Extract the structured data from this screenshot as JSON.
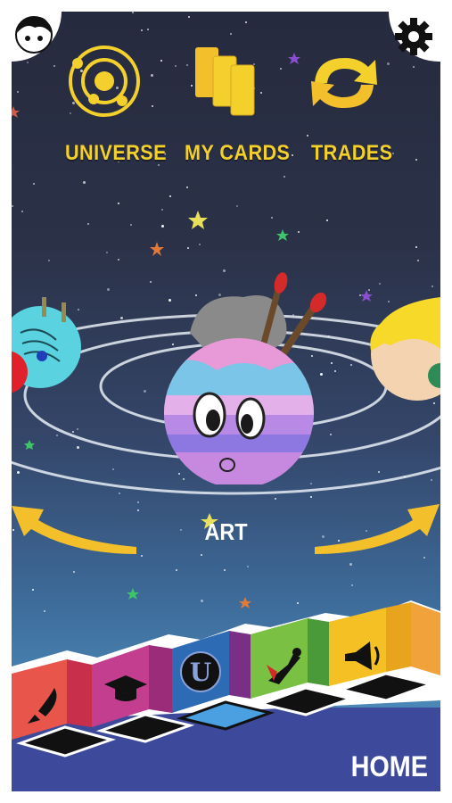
{
  "header": {
    "avatar_icon": "avatar-face-icon",
    "settings_icon": "gear-icon"
  },
  "menu": {
    "items": [
      {
        "label": "UNIVERSE",
        "icon": "orbit-icon"
      },
      {
        "label": "MY CARDS",
        "icon": "cards-icon"
      },
      {
        "label": "TRADES",
        "icon": "swap-arrows-icon"
      }
    ]
  },
  "carousel": {
    "current_planet": "ART",
    "prev_icon": "arrow-left-icon",
    "next_icon": "arrow-right-icon"
  },
  "categories": {
    "items": [
      {
        "icon": "rocket-icon",
        "color": "#e8554a"
      },
      {
        "icon": "graduation-cap-icon",
        "color": "#c43e8f"
      },
      {
        "icon": "u-logo-icon",
        "color": "#2e6bb5"
      },
      {
        "icon": "superhero-icon",
        "color": "#7ac043"
      },
      {
        "icon": "megaphone-icon",
        "color": "#f5c023"
      },
      {
        "icon": "blank-icon",
        "color": "#f2a23b"
      }
    ]
  },
  "footer": {
    "home_label": "HOME"
  },
  "colors": {
    "accent_yellow": "#f3d02c",
    "bottom_bar": "#3d4a9c"
  }
}
